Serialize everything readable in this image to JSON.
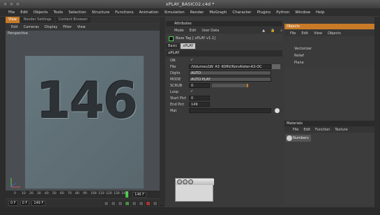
{
  "window": {
    "title": "xPLAY_BASIC02.c4d *"
  },
  "menubar": [
    "File",
    "Edit",
    "Objects",
    "Tools",
    "Selection",
    "Structure",
    "Functions",
    "Animation",
    "Simulation",
    "Render",
    "MoGraph",
    "Character",
    "Plugins",
    "Python",
    "Window",
    "Help"
  ],
  "left_tabs": [
    "View",
    "Render Settings",
    "Content Browser"
  ],
  "view_menu": [
    "Edit",
    "Cameras",
    "Display",
    "Filter",
    "View"
  ],
  "viewport": {
    "label": "Perspective",
    "number_text": "146"
  },
  "timeline": {
    "ticks": [
      "0",
      "10",
      "20",
      "30",
      "40",
      "50",
      "60",
      "70",
      "80",
      "90",
      "100",
      "110",
      "120",
      "130",
      "140"
    ],
    "current_frame": "146 F"
  },
  "time_controls": {
    "start": "0 F",
    "end": "149 F",
    "min": "0 F"
  },
  "attributes": {
    "panel_title": "Attributes",
    "menu": [
      "Mode",
      "Edit",
      "User Data"
    ],
    "header": "Base Tag [ xPLAY v1.1]",
    "tabs": [
      "Basic",
      "xPLAY"
    ],
    "selected_tab": "xPLAY",
    "section_title": "xPLAY",
    "fields": [
      {
        "label": "ON",
        "value": "✓"
      },
      {
        "label": "File",
        "value": "/Volumes/LW_A3_KORV/KorvAlster-A3-OC"
      },
      {
        "label": "Digits",
        "value": "AUTO"
      },
      {
        "label": "MODE",
        "value": "AUTO PLAY"
      },
      {
        "label": "SCRUB",
        "value": "0"
      },
      {
        "label": "Loop",
        "value": "✓"
      },
      {
        "label": "Start Pict",
        "value": "0"
      },
      {
        "label": "End Pict",
        "value": "149"
      },
      {
        "label": "Mat",
        "value": ""
      }
    ]
  },
  "objects": {
    "panel_title": "Objects",
    "menu": [
      "File",
      "Edit",
      "View",
      "Objects"
    ],
    "items": [
      {
        "label": "Vectorizer"
      },
      {
        "label": "Relief"
      },
      {
        "label": "Plane"
      }
    ]
  },
  "materials": {
    "panel_title": "Materials",
    "menu": [
      "File",
      "Edit",
      "Function",
      "Texture"
    ],
    "items": [
      {
        "label": "Numbers"
      }
    ]
  },
  "colors": {
    "accent": "#c87a28",
    "background": "#3a3a3a"
  }
}
